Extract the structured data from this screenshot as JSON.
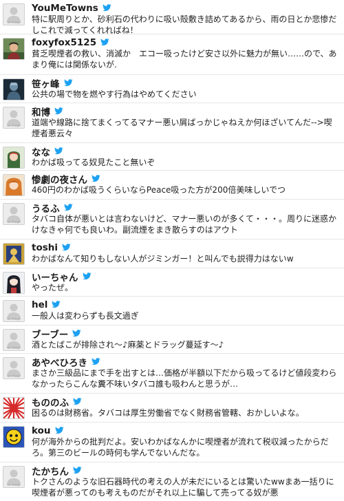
{
  "colors": {
    "bird": "#1da1f2",
    "divider": "#e6e6e6",
    "text": "#222222"
  },
  "no_image_label": "no image",
  "tweets": [
    {
      "name": "YouMeTowns",
      "avatar": "no-image",
      "text": "特に駅周りとか、砂利石の代わりに吸い殻敷き詰めてあるから、雨の日とか悲惨だしこれで減ってくれればね！"
    },
    {
      "name": "foxyfox5125",
      "avatar": "photo-person-green",
      "text": "貧乏喫煙者の救い、消滅か　エコー吸ったけど安さ以外に魅力が無い……ので、あまり俺には関係ないが."
    },
    {
      "name": "笹ヶ峰",
      "avatar": "photo-dark-figure",
      "text": "公共の場で物を燃やす行為はやめてください"
    },
    {
      "name": "和博",
      "avatar": "no-image",
      "text": "道端や線路に捨てまくってるマナー悪い屑ばっかじゃねえか何ほざいてんだ-->喫煙者悪云々"
    },
    {
      "name": "なな",
      "avatar": "photo-anime-girl-green",
      "text": "わかば吸ってる奴見たこと無いぞ"
    },
    {
      "name": "惨劇の夜さん",
      "avatar": "photo-anime-girl-orange",
      "text": "460円のわかば吸うくらいならPeace吸った方が200倍美味しいでつ"
    },
    {
      "name": "うるふ",
      "avatar": "no-image",
      "text": "タバコ自体が悪いとは言わないけど、マナー悪いのが多くて・・・。周りに迷惑かけなきゃ何でも良いわ。副流煙をまき散らすのはアウト"
    },
    {
      "name": "toshi",
      "avatar": "photo-golden-art",
      "text": "わかばなんて知りもしない人がジミンガー！と叫んでも説得力はないw"
    },
    {
      "name": "いーちゃん",
      "avatar": "photo-anime-girl-dark",
      "text": "やったぜ。"
    },
    {
      "name": "hel",
      "avatar": "no-image",
      "text": "一般人は変わらずも長文過ぎ"
    },
    {
      "name": "ブーブー",
      "avatar": "no-image",
      "text": "酒とたばこが排除され～♪麻薬とドラッグ蔓延す～♪"
    },
    {
      "name": "あやべひろき",
      "avatar": "no-image",
      "text": "まさか三級品にまで手を出すとは…価格が半額以下だから吸ってるけど値段変わらなかったらこんな糞不味いタバコ誰も吸わんと思うが…"
    },
    {
      "name": "もののふ",
      "avatar": "photo-rising-sun",
      "text": "困るのは財務省。タバコは厚生労働省でなく財務省管轄、おかしいよな。"
    },
    {
      "name": "kou",
      "avatar": "photo-yellow-face",
      "text": "何が海外からの批判だよ。安いわかばなんかに喫煙者が流れて税収減ったからだろ。第三のビールの時何も学んでないんだな。"
    },
    {
      "name": "たかちん",
      "avatar": "no-image",
      "text": "トクさんのような旧石器時代の考えの人が未だにいるとは驚いたwwまあ一括りに喫煙者が悪ってのも考えものだがそれ以上に騙して売ってる奴が悪"
    }
  ]
}
